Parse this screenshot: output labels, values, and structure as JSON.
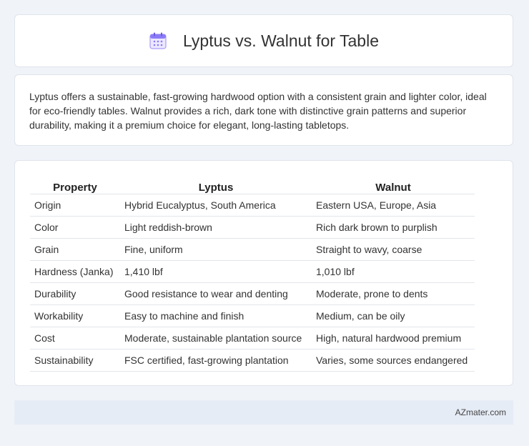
{
  "header": {
    "title": "Lyptus vs. Walnut for Table",
    "icon": "calendar-icon"
  },
  "summary": {
    "text": "Lyptus offers a sustainable, fast-growing hardwood option with a consistent grain and lighter color, ideal for eco-friendly tables. Walnut provides a rich, dark tone with distinctive grain patterns and superior durability, making it a premium choice for elegant, long-lasting tabletops."
  },
  "table": {
    "headers": [
      "Property",
      "Lyptus",
      "Walnut"
    ],
    "rows": [
      [
        "Origin",
        "Hybrid Eucalyptus, South America",
        "Eastern USA, Europe, Asia"
      ],
      [
        "Color",
        "Light reddish-brown",
        "Rich dark brown to purplish"
      ],
      [
        "Grain",
        "Fine, uniform",
        "Straight to wavy, coarse"
      ],
      [
        "Hardness (Janka)",
        "1,410 lbf",
        "1,010 lbf"
      ],
      [
        "Durability",
        "Good resistance to wear and denting",
        "Moderate, prone to dents"
      ],
      [
        "Workability",
        "Easy to machine and finish",
        "Medium, can be oily"
      ],
      [
        "Cost",
        "Moderate, sustainable plantation source",
        "High, natural hardwood premium"
      ],
      [
        "Sustainability",
        "FSC certified, fast-growing plantation",
        "Varies, some sources endangered"
      ]
    ]
  },
  "footer": {
    "brand": "AZmater.com"
  },
  "colors": {
    "background": "#f0f3f8",
    "card": "#ffffff",
    "footer": "#e6ecf6",
    "icon_accent": "#8b7cf6"
  }
}
